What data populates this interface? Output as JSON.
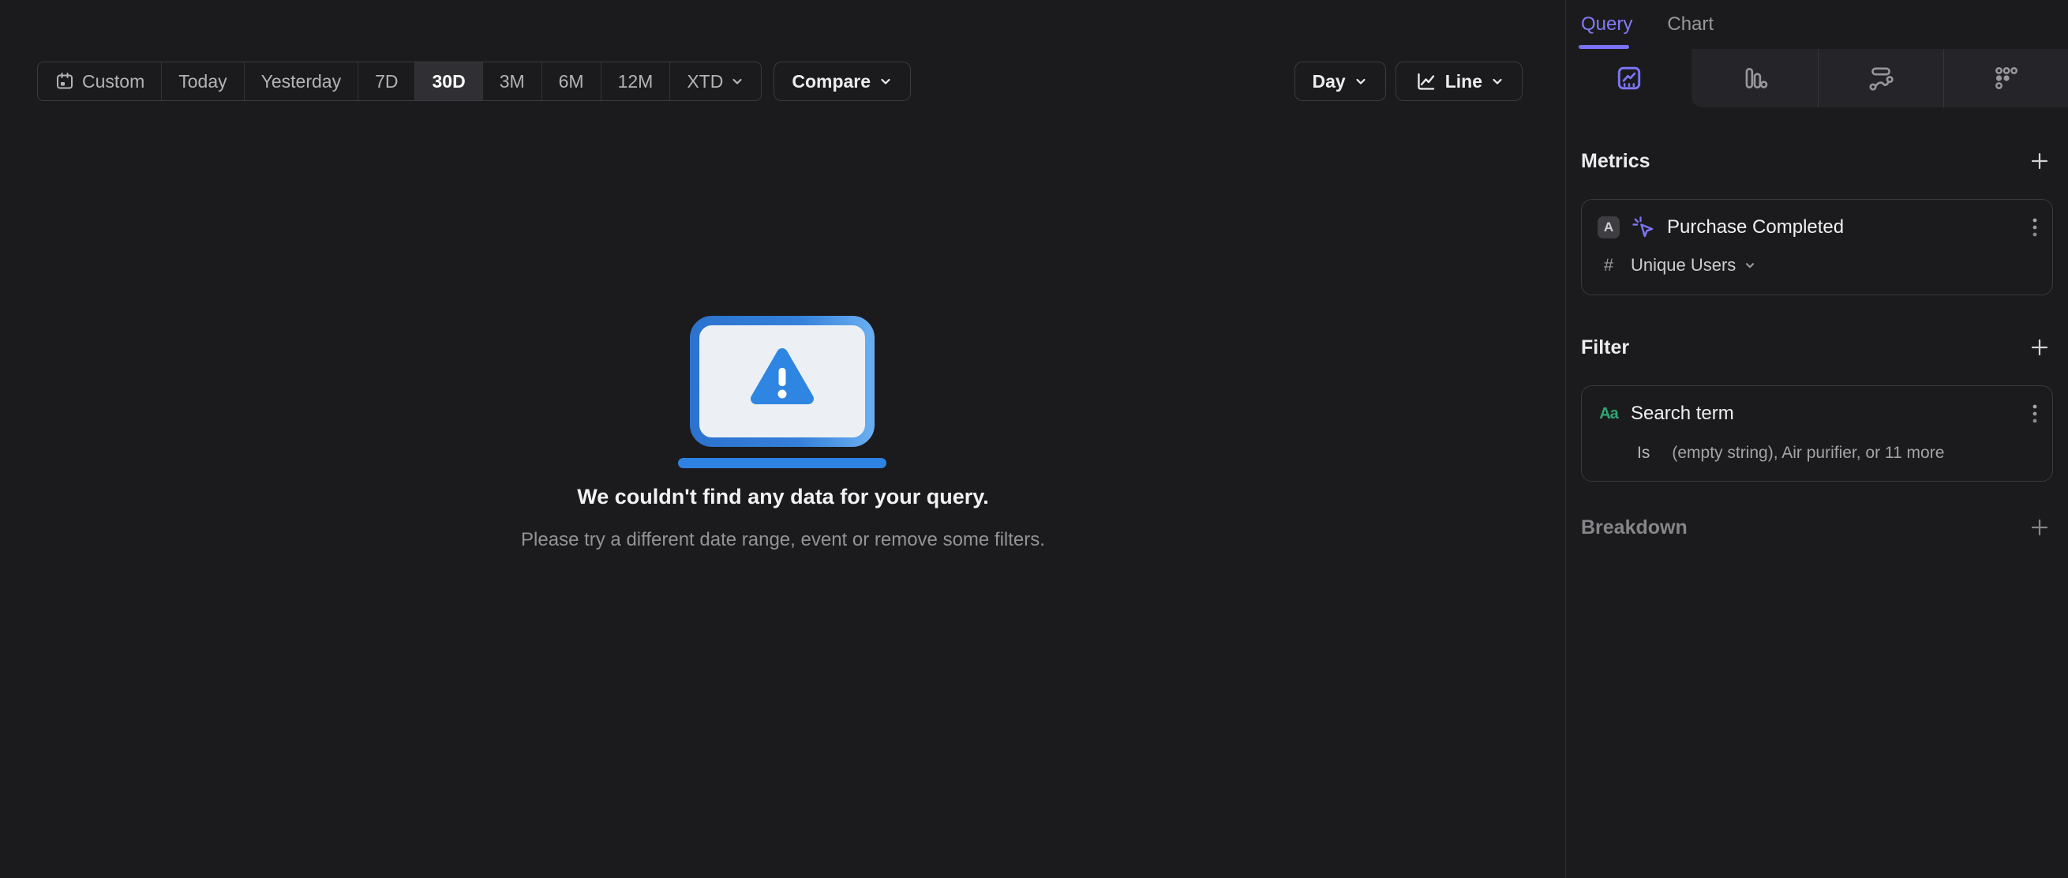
{
  "toolbar": {
    "date_buttons": [
      {
        "label": "Custom"
      },
      {
        "label": "Today"
      },
      {
        "label": "Yesterday"
      },
      {
        "label": "7D"
      },
      {
        "label": "30D"
      },
      {
        "label": "3M"
      },
      {
        "label": "6M"
      },
      {
        "label": "12M"
      },
      {
        "label": "XTD"
      }
    ],
    "selected_range": "30D",
    "compare_label": "Compare",
    "granularity_label": "Day",
    "chart_type_label": "Line"
  },
  "empty_state": {
    "title": "We couldn't find any data for your query.",
    "subtitle": "Please try a different date range, event or remove some filters."
  },
  "sidebar": {
    "tabs": {
      "query": "Query",
      "chart": "Chart"
    },
    "icon_tabs": [
      "insights",
      "funnels",
      "flows",
      "retention"
    ],
    "metrics": {
      "heading": "Metrics",
      "items": [
        {
          "letter": "A",
          "event": "Purchase Completed",
          "aggregation_symbol": "#",
          "aggregation": "Unique Users"
        }
      ]
    },
    "filter": {
      "heading": "Filter",
      "items": [
        {
          "type_badge": "Aa",
          "property": "Search term",
          "operator": "Is",
          "value": "(empty string), Air purifier, or 11 more"
        }
      ]
    },
    "breakdown": {
      "heading": "Breakdown"
    }
  },
  "colors": {
    "accent_purple": "#7c74f2",
    "filter_green": "#2fa673",
    "illustration_blue": "#2e84e0",
    "background": "#1b1b1d"
  }
}
